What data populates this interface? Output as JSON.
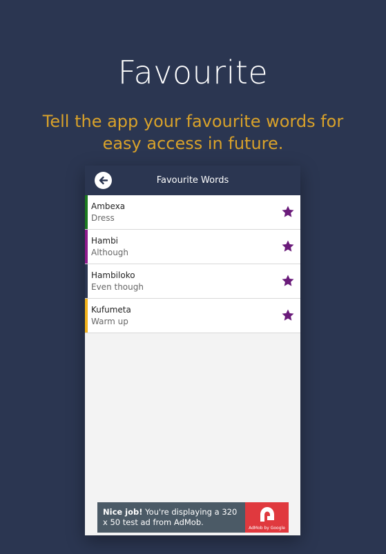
{
  "promo": {
    "title": "Favourite",
    "subtitle": "Tell the app your favourite words for easy access in future."
  },
  "appbar": {
    "title": "Favourite Words",
    "back_icon": "back-arrow-icon"
  },
  "colors": {
    "background": "#2b3651",
    "accent_text": "#d9a22a",
    "star": "#6a1b7a"
  },
  "favourites": [
    {
      "word": "Ambexa",
      "meaning": "Dress",
      "color": "#1b7a1f"
    },
    {
      "word": "Hambi",
      "meaning": "Although",
      "color": "#8e1a8c"
    },
    {
      "word": "Hambiloko",
      "meaning": "Even though",
      "color": "#2b3651"
    },
    {
      "word": "Kufumeta",
      "meaning": "Warm up",
      "color": "#f2b21b"
    }
  ],
  "ad": {
    "headline": "Nice job!",
    "body": "You're displaying a 320 x 50 test ad from AdMob.",
    "brand": "AdMob by Google"
  }
}
